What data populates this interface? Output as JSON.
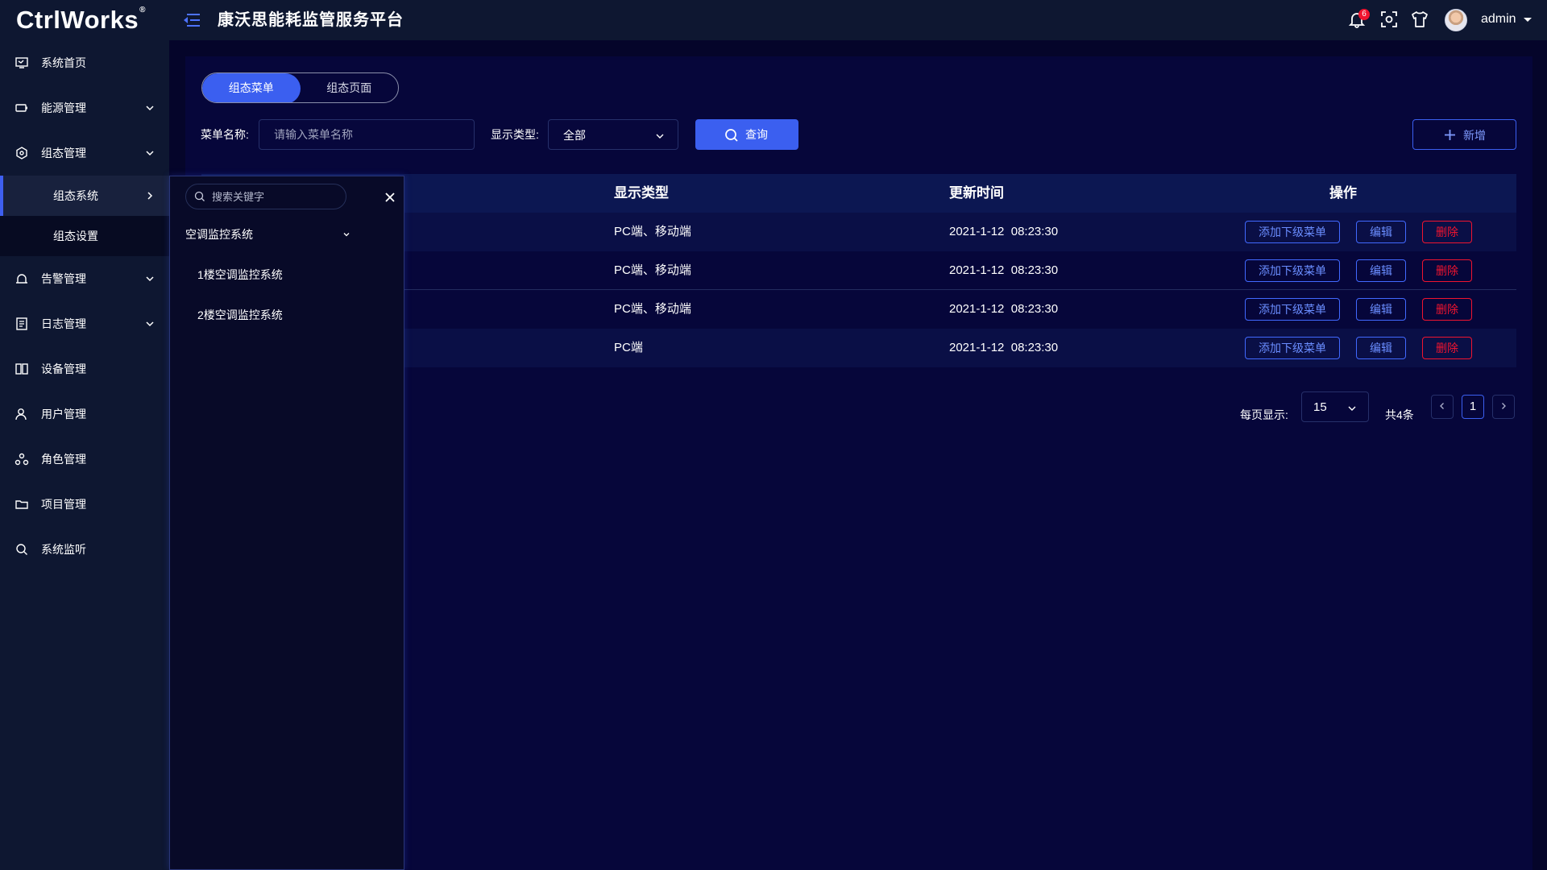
{
  "header": {
    "logo": "CtrlWorks",
    "title": "康沃思能耗监管服务平台",
    "notification_count": "6",
    "username": "admin"
  },
  "sidebar": {
    "items": [
      {
        "label": "系统首页",
        "icon": "monitor-icon"
      },
      {
        "label": "能源管理",
        "icon": "battery-icon"
      },
      {
        "label": "组态管理",
        "icon": "hexagon-icon"
      },
      {
        "label": "告警管理",
        "icon": "alarm-bell-icon"
      },
      {
        "label": "日志管理",
        "icon": "document-icon"
      },
      {
        "label": "设备管理",
        "icon": "device-icon"
      },
      {
        "label": "用户管理",
        "icon": "user-icon"
      },
      {
        "label": "角色管理",
        "icon": "role-icon"
      },
      {
        "label": "项目管理",
        "icon": "folder-icon"
      },
      {
        "label": "系统监听",
        "icon": "search-icon"
      }
    ],
    "sub_items": [
      "组态系统",
      "组态设置"
    ]
  },
  "flyout": {
    "search_placeholder": "搜索关键字",
    "group": "空调监控系统",
    "items": [
      "1楼空调监控系统",
      "2楼空调监控系统"
    ]
  },
  "main": {
    "tabs": [
      "组态菜单",
      "组态页面"
    ],
    "active_tab": "组态菜单",
    "filters": {
      "name_label": "菜单名称:",
      "name_placeholder": "请输入菜单名称",
      "type_label": "显示类型:",
      "type_value": "全部"
    },
    "query_button": "查询",
    "add_button": "新增",
    "table": {
      "columns": [
        "显示类型",
        "更新时间",
        "操作"
      ],
      "rows": [
        {
          "type": "PC端、移动端",
          "updated": "2021-1-12  08:23:30"
        },
        {
          "type": "PC端、移动端",
          "updated": "2021-1-12  08:23:30"
        },
        {
          "type": "PC端、移动端",
          "updated": "2021-1-12  08:23:30"
        },
        {
          "type": "PC端",
          "updated": "2021-1-12  08:23:30"
        }
      ],
      "actions": {
        "add_child": "添加下级菜单",
        "edit": "编辑",
        "delete": "删除"
      }
    },
    "pagination": {
      "per_page_label": "每页显示:",
      "per_page": "15",
      "total": "共4条",
      "current_page": "1"
    }
  },
  "colors": {
    "accent": "#3b5ff0",
    "danger": "#f0142f",
    "background": "#05052a",
    "sidebar": "#0e1731"
  }
}
